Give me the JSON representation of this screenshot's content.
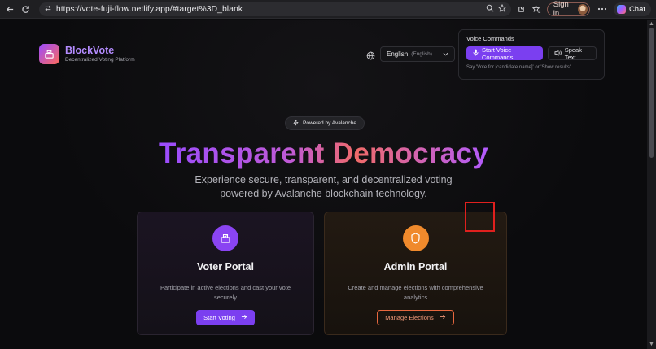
{
  "browser": {
    "url": "https://vote-fuji-flow.netlify.app/#target%3D_blank",
    "sign_in_label": "Sign in",
    "chat_label": "Chat"
  },
  "brand": {
    "name": "BlockVote",
    "tagline": "Decentralized Voting Platform"
  },
  "language": {
    "selected": "English",
    "selected_native": "(English)"
  },
  "voice": {
    "title": "Voice Commands",
    "start_label": "Start Voice Commands",
    "speak_label": "Speak Text",
    "hint": "Say 'Vote for [candidate name]' or 'Show results'"
  },
  "hero": {
    "badge": "Powered by Avalanche",
    "title": "Transparent Democracy",
    "subtitle_line1": "Experience secure, transparent, and decentralized voting",
    "subtitle_line2": "powered by Avalanche blockchain technology."
  },
  "cards": {
    "voter": {
      "title": "Voter Portal",
      "desc_line1": "Participate in active elections and cast your vote",
      "desc_line2": "securely",
      "button": "Start Voting"
    },
    "admin": {
      "title": "Admin Portal",
      "desc_line1": "Create and manage elections with comprehensive",
      "desc_line2": "analytics",
      "button": "Manage Elections"
    }
  },
  "colors": {
    "accent_purple": "#7b3ff0",
    "accent_orange": "#f08a2c",
    "highlight_box": "#e0201e"
  }
}
